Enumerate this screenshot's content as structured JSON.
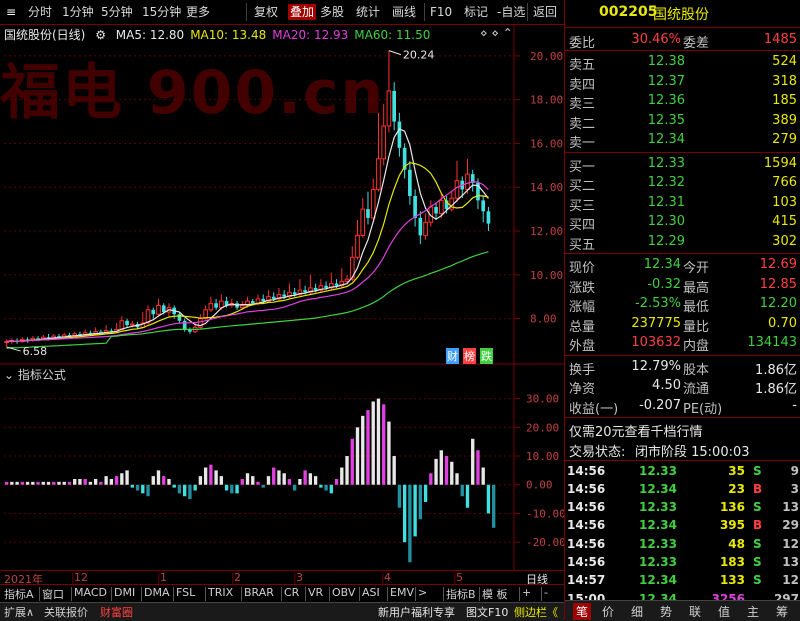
{
  "toolbar": {
    "items": [
      "分时",
      "1分钟",
      "5分钟",
      "15分钟",
      "更多",
      "复权",
      "叠加",
      "多股",
      "统计",
      "画线",
      "F10",
      "标记",
      "-自选",
      "返回"
    ],
    "active": "叠加"
  },
  "watermark": "福电 900.cn",
  "stock": {
    "code": "002205",
    "name": "国统股份",
    "chart_title": "国统股份(日线)"
  },
  "ma_legend": [
    {
      "label": "MA5: 12.80",
      "color": "#e8e8e8"
    },
    {
      "label": "MA10: 13.48",
      "color": "#e8e800"
    },
    {
      "label": "MA20: 12.93",
      "color": "#e040e0"
    },
    {
      "label": "MA60: 11.50",
      "color": "#40d040"
    }
  ],
  "cbz": [
    "财",
    "榜",
    "跌"
  ],
  "indicator_title": "指标公式",
  "chart_data": {
    "type": "candlestick",
    "y_ticks": [
      "20.00",
      "18.00",
      "16.00",
      "14.00",
      "12.00",
      "10.00",
      "8.00"
    ],
    "ylim": [
      6.2,
      21.0
    ],
    "annotations": {
      "high": "20.24",
      "low": "6.58"
    },
    "ind_y_ticks": [
      "30.00",
      "20.00",
      "10.00",
      "0.00",
      "-10.00",
      "-20.00"
    ],
    "ind_ylim": [
      -29,
      33
    ],
    "x_labels": [
      "2021年",
      "12",
      "1",
      "2",
      "3",
      "4",
      "5"
    ],
    "x_label_right": "日线",
    "candles": [
      [
        6.9,
        6.95,
        7.05,
        6.7
      ],
      [
        6.95,
        7.0,
        7.1,
        6.85
      ],
      [
        7.0,
        6.95,
        7.1,
        6.85
      ],
      [
        6.95,
        7.05,
        7.15,
        6.9
      ],
      [
        7.05,
        7.0,
        7.15,
        6.9
      ],
      [
        7.0,
        7.1,
        7.2,
        6.95
      ],
      [
        7.1,
        7.05,
        7.2,
        7.0
      ],
      [
        7.05,
        7.15,
        7.25,
        7.0
      ],
      [
        7.15,
        7.1,
        7.3,
        7.0
      ],
      [
        7.1,
        7.2,
        7.3,
        7.05
      ],
      [
        7.2,
        7.15,
        7.3,
        7.1
      ],
      [
        7.15,
        7.25,
        7.35,
        7.1
      ],
      [
        7.25,
        7.2,
        7.35,
        7.15
      ],
      [
        7.2,
        7.3,
        7.4,
        7.15
      ],
      [
        7.3,
        7.25,
        7.4,
        7.2
      ],
      [
        7.25,
        7.35,
        7.5,
        7.2
      ],
      [
        7.35,
        7.3,
        7.45,
        7.25
      ],
      [
        7.3,
        7.4,
        7.6,
        7.25
      ],
      [
        7.4,
        7.35,
        7.5,
        7.3
      ],
      [
        7.35,
        7.45,
        7.7,
        7.3
      ],
      [
        7.45,
        7.4,
        7.55,
        7.35
      ],
      [
        7.4,
        7.5,
        7.8,
        7.35
      ],
      [
        7.5,
        7.9,
        8.1,
        7.45
      ],
      [
        7.9,
        7.7,
        8.0,
        7.6
      ],
      [
        7.7,
        7.75,
        7.9,
        7.6
      ],
      [
        7.75,
        7.6,
        7.85,
        7.5
      ],
      [
        7.6,
        7.8,
        8.3,
        7.55
      ],
      [
        7.8,
        8.4,
        8.6,
        7.75
      ],
      [
        8.4,
        8.2,
        8.5,
        8.0
      ],
      [
        8.2,
        8.6,
        8.9,
        8.1
      ],
      [
        8.6,
        8.3,
        8.7,
        8.2
      ],
      [
        8.3,
        8.5,
        8.7,
        8.1
      ],
      [
        8.5,
        8.2,
        8.6,
        8.0
      ],
      [
        8.2,
        7.9,
        8.3,
        7.8
      ],
      [
        7.9,
        7.5,
        8.0,
        7.4
      ],
      [
        7.5,
        7.4,
        7.6,
        7.3
      ],
      [
        7.4,
        7.6,
        7.8,
        7.35
      ],
      [
        7.6,
        8.0,
        8.2,
        7.55
      ],
      [
        8.0,
        8.4,
        8.6,
        7.95
      ],
      [
        8.4,
        8.7,
        9.0,
        8.3
      ],
      [
        8.7,
        8.5,
        8.9,
        8.4
      ],
      [
        8.5,
        8.8,
        9.1,
        8.4
      ],
      [
        8.8,
        8.6,
        9.0,
        8.5
      ],
      [
        8.6,
        8.7,
        8.9,
        8.5
      ],
      [
        8.7,
        8.5,
        8.8,
        8.4
      ],
      [
        8.5,
        8.6,
        8.8,
        8.4
      ],
      [
        8.6,
        8.8,
        9.0,
        8.5
      ],
      [
        8.8,
        8.7,
        8.9,
        8.6
      ],
      [
        8.7,
        8.9,
        9.1,
        8.6
      ],
      [
        8.9,
        8.8,
        9.1,
        8.7
      ],
      [
        8.8,
        9.0,
        9.3,
        8.7
      ],
      [
        9.0,
        8.9,
        9.2,
        8.8
      ],
      [
        8.9,
        9.1,
        9.4,
        8.8
      ],
      [
        9.1,
        9.0,
        9.3,
        8.9
      ],
      [
        9.0,
        9.2,
        9.6,
        8.9
      ],
      [
        9.2,
        9.1,
        9.4,
        9.0
      ],
      [
        9.1,
        9.3,
        9.8,
        9.0
      ],
      [
        9.3,
        9.2,
        9.5,
        9.1
      ],
      [
        9.2,
        9.4,
        10.0,
        9.1
      ],
      [
        9.4,
        9.3,
        9.6,
        9.2
      ],
      [
        9.3,
        9.5,
        9.8,
        9.2
      ],
      [
        9.5,
        9.4,
        9.7,
        9.3
      ],
      [
        9.4,
        9.6,
        10.1,
        9.3
      ],
      [
        9.6,
        9.5,
        9.8,
        9.4
      ],
      [
        9.5,
        9.7,
        10.3,
        9.4
      ],
      [
        9.7,
        9.8,
        10.0,
        9.6
      ],
      [
        9.8,
        10.8,
        11.3,
        9.7
      ],
      [
        10.8,
        11.8,
        12.5,
        10.7
      ],
      [
        11.8,
        13.0,
        13.5,
        11.7
      ],
      [
        13.0,
        12.6,
        13.8,
        12.3
      ],
      [
        12.6,
        13.9,
        14.4,
        12.5
      ],
      [
        13.9,
        15.3,
        17.4,
        13.8
      ],
      [
        15.3,
        16.8,
        17.8,
        15.0
      ],
      [
        16.8,
        18.4,
        20.24,
        16.5
      ],
      [
        18.4,
        17.0,
        18.8,
        16.6
      ],
      [
        17.0,
        15.8,
        17.4,
        15.4
      ],
      [
        15.8,
        14.8,
        16.0,
        14.4
      ],
      [
        14.8,
        13.6,
        15.2,
        13.2
      ],
      [
        13.6,
        12.6,
        13.9,
        12.2
      ],
      [
        12.6,
        11.8,
        12.9,
        11.4
      ],
      [
        11.8,
        12.4,
        12.8,
        11.6
      ],
      [
        12.4,
        13.1,
        13.4,
        12.2
      ],
      [
        13.1,
        12.8,
        13.3,
        12.5
      ],
      [
        12.8,
        13.4,
        13.7,
        12.6
      ],
      [
        13.4,
        13.0,
        13.6,
        12.8
      ],
      [
        13.0,
        13.5,
        13.8,
        12.9
      ],
      [
        13.5,
        14.3,
        15.2,
        13.3
      ],
      [
        14.3,
        13.9,
        14.5,
        13.5
      ],
      [
        13.9,
        14.6,
        15.3,
        13.7
      ],
      [
        14.6,
        14.2,
        14.8,
        13.8
      ],
      [
        14.2,
        13.4,
        14.4,
        13.0
      ],
      [
        13.4,
        12.9,
        13.6,
        12.4
      ],
      [
        12.9,
        12.34,
        13.1,
        12.0
      ]
    ],
    "ind_values": [
      1,
      1,
      1,
      1,
      1,
      1,
      1,
      1,
      1,
      1,
      1,
      1,
      1,
      2,
      2,
      2,
      1,
      2,
      1,
      3,
      2,
      3,
      4,
      5,
      -1,
      -2,
      -3,
      -4,
      3,
      5,
      3,
      2,
      -1,
      -3,
      -4,
      -5,
      -2,
      3,
      6,
      7,
      5,
      3,
      -2,
      -3,
      -3,
      2,
      4,
      3,
      1,
      -1,
      3,
      6,
      5,
      4,
      2,
      -2,
      2,
      5,
      4,
      3,
      -1,
      -2,
      -3,
      2,
      6,
      10,
      16,
      20,
      24,
      26,
      29,
      30,
      28,
      22,
      10,
      -8,
      -20,
      -27,
      -18,
      -12,
      -6,
      4,
      9,
      12,
      10,
      8,
      4,
      -4,
      -8,
      16,
      12,
      6,
      -10,
      -15
    ]
  },
  "indicator_tabs": [
    "指标A",
    "窗口",
    "MACD",
    "DMI",
    "DMA",
    "FSL",
    "TRIX",
    "BRAR",
    "CR",
    "VR",
    "OBV",
    "ASI",
    "EMV",
    ">",
    "指标B",
    "模 板",
    "+",
    "-"
  ],
  "status_left": [
    "扩展∧",
    "关联报价",
    "财富圈"
  ],
  "status_right": [
    "新用户福利专享",
    "图文F10",
    "侧边栏《"
  ],
  "quote": {
    "weibi": {
      "label": "委比",
      "value": "30.46%",
      "label2": "委差",
      "value2": "1485"
    },
    "asks": [
      {
        "label": "卖五",
        "price": "12.38",
        "vol": "524"
      },
      {
        "label": "卖四",
        "price": "12.37",
        "vol": "318"
      },
      {
        "label": "卖三",
        "price": "12.36",
        "vol": "185"
      },
      {
        "label": "卖二",
        "price": "12.35",
        "vol": "389"
      },
      {
        "label": "卖一",
        "price": "12.34",
        "vol": "279"
      }
    ],
    "bids": [
      {
        "label": "买一",
        "price": "12.33",
        "vol": "1594"
      },
      {
        "label": "买二",
        "price": "12.32",
        "vol": "766"
      },
      {
        "label": "买三",
        "price": "12.31",
        "vol": "103"
      },
      {
        "label": "买四",
        "price": "12.30",
        "vol": "415"
      },
      {
        "label": "买五",
        "price": "12.29",
        "vol": "302"
      }
    ],
    "stats": [
      {
        "l1": "现价",
        "v1": "12.34",
        "c1": "grn",
        "l2": "今开",
        "v2": "12.69",
        "c2": "red"
      },
      {
        "l1": "涨跌",
        "v1": "-0.32",
        "c1": "grn",
        "l2": "最高",
        "v2": "12.85",
        "c2": "red"
      },
      {
        "l1": "涨幅",
        "v1": "-2.53%",
        "c1": "grn",
        "l2": "最低",
        "v2": "12.20",
        "c2": "grn"
      },
      {
        "l1": "总量",
        "v1": "237775",
        "c1": "yel",
        "l2": "量比",
        "v2": "0.70",
        "c2": "yel"
      },
      {
        "l1": "外盘",
        "v1": "103632",
        "c1": "red",
        "l2": "内盘",
        "v2": "134143",
        "c2": "grn"
      }
    ],
    "fin": [
      {
        "l1": "换手",
        "v1": "12.79%",
        "l2": "股本",
        "v2": "1.86亿"
      },
      {
        "l1": "净资",
        "v1": "4.50",
        "l2": "流通",
        "v2": "1.86亿"
      },
      {
        "l1": "收益(一)",
        "v1": "-0.207",
        "l2": "PE(动)",
        "v2": "-"
      }
    ],
    "promo": "仅需20元查看千档行情",
    "trade_state": {
      "label": "交易状态:",
      "value": "闭市阶段 15:00:03"
    }
  },
  "ticks": [
    {
      "time": "14:56",
      "price": "12.33",
      "vol": "35",
      "bs": "S",
      "n": "9"
    },
    {
      "time": "14:56",
      "price": "12.34",
      "vol": "23",
      "bs": "B",
      "n": "3"
    },
    {
      "time": "14:56",
      "price": "12.33",
      "vol": "136",
      "bs": "S",
      "n": "13"
    },
    {
      "time": "14:56",
      "price": "12.34",
      "vol": "395",
      "bs": "B",
      "n": "29"
    },
    {
      "time": "14:56",
      "price": "12.33",
      "vol": "48",
      "bs": "S",
      "n": "12"
    },
    {
      "time": "14:56",
      "price": "12.33",
      "vol": "183",
      "bs": "S",
      "n": "13"
    },
    {
      "time": "14:57",
      "price": "12.34",
      "vol": "133",
      "bs": "S",
      "n": "12"
    },
    {
      "time": "15:00",
      "price": "12.34",
      "vol": "3256",
      "bs": "",
      "n": "297"
    }
  ],
  "right_tabs": [
    "笔",
    "价",
    "细",
    "势",
    "联",
    "值",
    "主",
    "筹"
  ]
}
